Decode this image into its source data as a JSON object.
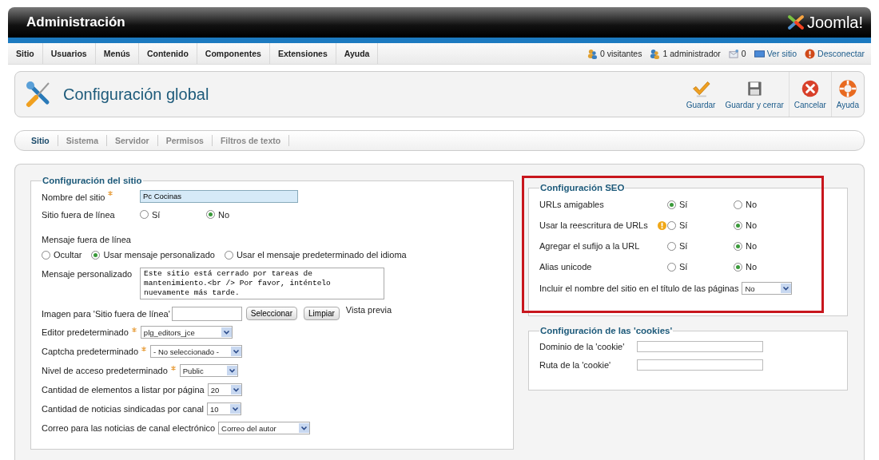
{
  "header": {
    "title": "Administración",
    "logo_text": "Joomla!"
  },
  "menu": [
    "Sitio",
    "Usuarios",
    "Menús",
    "Contenido",
    "Componentes",
    "Extensiones",
    "Ayuda"
  ],
  "status": [
    {
      "kind": "visitors",
      "text": "0 visitantes"
    },
    {
      "kind": "admins",
      "text": "1 administrador"
    },
    {
      "kind": "messages",
      "text": "0"
    },
    {
      "kind": "view",
      "text": "Ver sitio"
    },
    {
      "kind": "logout",
      "text": "Desconectar"
    }
  ],
  "page_title": "Configuración global",
  "toolbar": [
    {
      "kind": "save",
      "label": "Guardar"
    },
    {
      "kind": "save_close",
      "label": "Guardar y cerrar"
    },
    {
      "kind": "cancel",
      "label": "Cancelar"
    },
    {
      "kind": "help",
      "label": "Ayuda"
    }
  ],
  "tabs": [
    {
      "label": "Sitio",
      "selected": true
    },
    {
      "label": "Sistema",
      "selected": false
    },
    {
      "label": "Servidor",
      "selected": false
    },
    {
      "label": "Permisos",
      "selected": false
    },
    {
      "label": "Filtros de texto",
      "selected": false
    }
  ],
  "site_config": {
    "title": "Configuración del sitio",
    "rows": [
      {
        "kind": "text",
        "label": "Nombre del sitio",
        "required": true,
        "value": "Pc Cocinas",
        "focused": true
      },
      {
        "kind": "radio",
        "label": "Sitio fuera de línea",
        "options": [
          {
            "label": "Sí",
            "selected": false
          },
          {
            "label": "No",
            "selected": true
          }
        ]
      },
      {
        "kind": "stacked_radio",
        "label": "Mensaje fuera de línea",
        "options": [
          {
            "label": "Ocultar",
            "selected": false
          },
          {
            "label": "Usar mensaje personalizado",
            "selected": true
          },
          {
            "label": "Usar el mensaje predeterminado del idioma",
            "selected": false
          }
        ]
      },
      {
        "kind": "textarea",
        "label": "Mensaje personalizado",
        "value": "Este sitio está cerrado por tareas de mantenimiento.<br /> Por favor, inténtelo nuevamente más tarde."
      },
      {
        "kind": "media",
        "label": "Imagen para 'Sitio fuera de línea'",
        "buttons": [
          "Seleccionar",
          "Limpiar"
        ],
        "preview": "Vista previa"
      },
      {
        "kind": "select",
        "label": "Editor predeterminado",
        "required": true,
        "value": "plg_editors_jce"
      },
      {
        "kind": "select",
        "label": "Captcha predeterminado",
        "required": true,
        "value": "- No seleccionado -"
      },
      {
        "kind": "select",
        "label": "Nivel de acceso predeterminado",
        "required": true,
        "value": "Public"
      },
      {
        "kind": "select",
        "label": "Cantidad de elementos a listar por página",
        "required": false,
        "value": "20"
      },
      {
        "kind": "select",
        "label": "Cantidad de noticias sindicadas por canal",
        "required": false,
        "value": "10"
      },
      {
        "kind": "select",
        "label": "Correo para las noticias de canal electrónico",
        "required": false,
        "value": "Correo del autor"
      }
    ]
  },
  "seo_config": {
    "title": "Configuración SEO",
    "highlighted": true,
    "rows": [
      {
        "kind": "radio",
        "label": "URLs amigables",
        "warning": false,
        "options": [
          {
            "label": "Sí",
            "selected": true
          },
          {
            "label": "No",
            "selected": false
          }
        ]
      },
      {
        "kind": "radio",
        "label": "Usar la reescritura de URLs",
        "warning": true,
        "options": [
          {
            "label": "Sí",
            "selected": false
          },
          {
            "label": "No",
            "selected": true
          }
        ]
      },
      {
        "kind": "radio",
        "label": "Agregar el sufijo a la URL",
        "warning": false,
        "options": [
          {
            "label": "Sí",
            "selected": false
          },
          {
            "label": "No",
            "selected": true
          }
        ]
      },
      {
        "kind": "radio",
        "label": "Alias unicode",
        "warning": false,
        "options": [
          {
            "label": "Sí",
            "selected": false
          },
          {
            "label": "No",
            "selected": true
          }
        ]
      },
      {
        "kind": "select",
        "label": "Incluir el nombre del sitio en el título de las páginas",
        "required": false,
        "value": "No"
      }
    ]
  },
  "cookie_config": {
    "title": "Configuración de las 'cookies'",
    "rows": [
      {
        "kind": "text",
        "label": "Dominio de la 'cookie'",
        "required": false,
        "focused": false
      },
      {
        "kind": "text",
        "label": "Ruta de la 'cookie'",
        "required": false,
        "focused": false
      }
    ]
  }
}
